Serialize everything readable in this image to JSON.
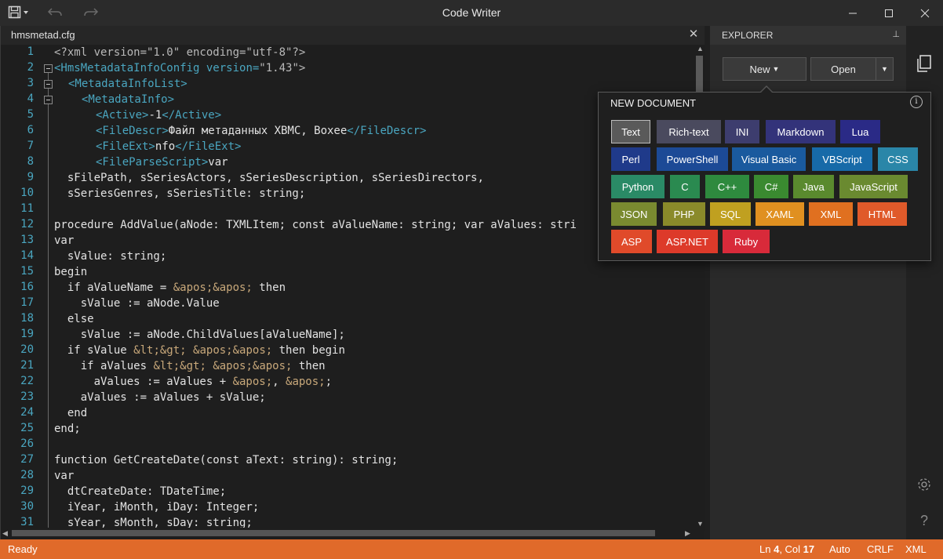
{
  "window": {
    "title": "Code Writer"
  },
  "editor": {
    "tab_name": "hmsmetad.cfg",
    "line_numbers": [
      "1",
      "2",
      "3",
      "4",
      "5",
      "6",
      "7",
      "8",
      "9",
      "10",
      "11",
      "12",
      "13",
      "14",
      "15",
      "16",
      "17",
      "18",
      "19",
      "20",
      "21",
      "22",
      "23",
      "24",
      "25",
      "26",
      "27",
      "28",
      "29",
      "30",
      "31"
    ],
    "lines": {
      "l1": "<?xml version=\"1.0\" encoding=\"utf-8\"?>",
      "l2_tag": "<HmsMetadataInfoConfig",
      "l2_attr": " version=",
      "l2_val": "\"1.43\">",
      "l3": "<MetadataInfoList>",
      "l4": "<MetadataInfo>",
      "l5_open": "<Active>",
      "l5_text": "-1",
      "l5_close": "</Active>",
      "l6_open": "<FileDescr>",
      "l6_text": "Файл метаданных XBMC, Boxee",
      "l6_close": "</FileDescr>",
      "l7_open": "<FileExt>",
      "l7_text": "nfo",
      "l7_close": "</FileExt>",
      "l8_open": "<FileParseScript>",
      "l8_text": "var",
      "l9": "  sFilePath, sSeriesActors, sSeriesDescription, sSeriesDirectors,",
      "l10": "  sSeriesGenres, sSeriesTitle: string;",
      "l11": "",
      "l12": "procedure AddValue(aNode: TXMLItem; const aValueName: string; var aValues: stri",
      "l13": "var",
      "l14": "  sValue: string;",
      "l15": "begin",
      "l16_a": "  if aValueName = ",
      "l16_b": "&apos;&apos;",
      "l16_c": " then",
      "l17": "    sValue := aNode.Value",
      "l18": "  else",
      "l19": "    sValue := aNode.ChildValues[aValueName];",
      "l20_a": "  if sValue ",
      "l20_b": "&lt;&gt;",
      "l20_c": " ",
      "l20_d": "&apos;&apos;",
      "l20_e": " then begin",
      "l21_a": "    if aValues ",
      "l21_b": "&lt;&gt;",
      "l21_c": " ",
      "l21_d": "&apos;&apos;",
      "l21_e": " then",
      "l22_a": "      aValues := aValues + ",
      "l22_b": "&apos;",
      "l22_c": ", ",
      "l22_d": "&apos;",
      "l22_e": ";",
      "l23": "    aValues := aValues + sValue;",
      "l24": "  end",
      "l25": "end;",
      "l26": "",
      "l27": "function GetCreateDate(const aText: string): string;",
      "l28": "var",
      "l29": "  dtCreateDate: TDateTime;",
      "l30": "  iYear, iMonth, iDay: Integer;",
      "l31": "  sYear, sMonth, sDay: string;"
    }
  },
  "explorer": {
    "title": "EXPLORER",
    "new_label": "New",
    "open_label": "Open"
  },
  "popup": {
    "title": "NEW DOCUMENT",
    "languages": [
      {
        "label": "Text",
        "color": "#5a5a5a"
      },
      {
        "label": "Rich-text",
        "color": "#4a4a5e"
      },
      {
        "label": "INI",
        "color": "#3d3d6e"
      },
      {
        "label": "Markdown",
        "color": "#33337a"
      },
      {
        "label": "Lua",
        "color": "#2a2a86"
      },
      {
        "label": "Perl",
        "color": "#1f3a8a"
      },
      {
        "label": "PowerShell",
        "color": "#1c4a96"
      },
      {
        "label": "Visual Basic",
        "color": "#1a5a9e"
      },
      {
        "label": "VBScript",
        "color": "#176aa8"
      },
      {
        "label": "CSS",
        "color": "#2a86a8"
      },
      {
        "label": "Python",
        "color": "#2a8a66"
      },
      {
        "label": "C",
        "color": "#2a8a50"
      },
      {
        "label": "C++",
        "color": "#2e8a3e"
      },
      {
        "label": "C#",
        "color": "#3a8a30"
      },
      {
        "label": "Java",
        "color": "#5a8a2e"
      },
      {
        "label": "JavaScript",
        "color": "#6a8a30"
      },
      {
        "label": "JSON",
        "color": "#7a8a30"
      },
      {
        "label": "PHP",
        "color": "#8a8a2a"
      },
      {
        "label": "SQL",
        "color": "#c0a020"
      },
      {
        "label": "XAML",
        "color": "#e09020"
      },
      {
        "label": "XML",
        "color": "#e07020"
      },
      {
        "label": "HTML",
        "color": "#e05a2a"
      },
      {
        "label": "ASP",
        "color": "#e04a2a"
      },
      {
        "label": "ASP.NET",
        "color": "#dd3a2a"
      },
      {
        "label": "Ruby",
        "color": "#d82a3a"
      }
    ]
  },
  "status": {
    "ready": "Ready",
    "ln_label": "Ln ",
    "ln_value": "4",
    "col_label": ", Col ",
    "col_value": "17",
    "auto": "Auto",
    "crlf": "CRLF",
    "xml": "XML"
  },
  "colors": {
    "status_bar": "#e06a2a",
    "line_number": "#4aa6c0",
    "xml_tag": "#4aa6c0"
  }
}
